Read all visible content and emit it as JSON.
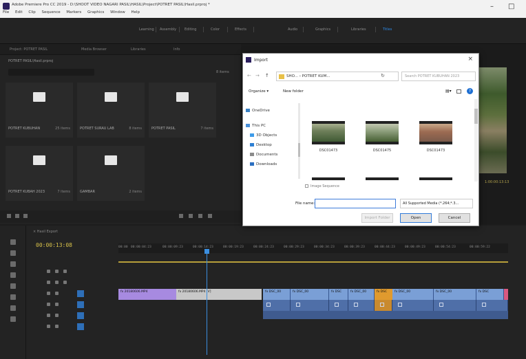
{
  "window": {
    "title": "Adobe Premiere Pro CC 2019 - D:\\SHOOT VIDEO NAGARI PASIL\\HASIL\\Project\\POTRET PASIL\\Hasil.prproj *",
    "menu": [
      "File",
      "Edit",
      "Clip",
      "Sequence",
      "Markers",
      "Graphics",
      "Window",
      "Help"
    ],
    "controls": {
      "minimize": "–",
      "maximize": "□"
    }
  },
  "workspace_tabs": [
    {
      "label": "Learning",
      "active": false
    },
    {
      "label": "Assembly",
      "active": false
    },
    {
      "label": "Editing",
      "active": false
    },
    {
      "label": "Color",
      "active": false
    },
    {
      "label": "Effects",
      "active": false
    },
    {
      "label": "Audio",
      "active": false
    },
    {
      "label": "Graphics",
      "active": false
    },
    {
      "label": "Libraries",
      "active": false
    },
    {
      "label": "Titles",
      "active": true
    }
  ],
  "project_panel": {
    "tabs": [
      "Project: POTRET PASIL",
      "Media Browser",
      "Libraries",
      "Info"
    ],
    "path": "POTRET PASIL\\Hasil.prproj",
    "count": "8 items",
    "bins": [
      {
        "name": "POTRET KUBUHAN",
        "items": "25 items"
      },
      {
        "name": "POTRET SURAU LAB",
        "items": "8 items"
      },
      {
        "name": "POTRET PASIL",
        "items": "7 items"
      },
      {
        "name": "POTRET KUBAH 2023",
        "items": "7 items"
      },
      {
        "name": "GAMBAR",
        "items": "2 items"
      }
    ]
  },
  "monitor": {
    "timecode": "1:00:00:13:13"
  },
  "timeline": {
    "tab": "× Hasil Export",
    "timecode": "00:00:13:08",
    "ruler_labels": [
      "00:00",
      "00:00:04:23",
      "00:00:09:23",
      "00:00:14:23",
      "00:00:19:23",
      "00:00:24:23",
      "00:00:29:23",
      "00:00:34:23",
      "00:00:39:23",
      "00:00:44:23",
      "00:00:49:23",
      "00:00:54:23",
      "00:00:59:22"
    ],
    "clips": [
      {
        "label": "fx 20180606.MP4",
        "color": "purple"
      },
      {
        "label": "fx 20180606.MP4 [V]",
        "color": "gray"
      },
      {
        "label": "fx DSC_00",
        "color": "blue"
      },
      {
        "label": "fx DSC_00",
        "color": "blue"
      },
      {
        "label": "fx DSC",
        "color": "blue"
      },
      {
        "label": "fx DSC_00",
        "color": "blue"
      },
      {
        "label": "fx DSC",
        "color": "orange"
      },
      {
        "label": "fx DSC_00",
        "color": "blue"
      },
      {
        "label": "fx DSC_00",
        "color": "blue"
      },
      {
        "label": "fx DSC",
        "color": "blue"
      }
    ]
  },
  "import_dialog": {
    "title": "Import",
    "close": "×",
    "address": "SHO... › POTRET KUM...",
    "search_placeholder": "Search POTRET KUBUHAN 2023",
    "organize": "Organize ▾",
    "new_folder": "New folder",
    "nav_items": [
      {
        "label": "OneDrive",
        "icon_color": "#3b82c4"
      },
      {
        "label": "This PC",
        "icon_color": "#4a90d9"
      },
      {
        "label": "3D Objects",
        "icon_color": "#3d9be9"
      },
      {
        "label": "Desktop",
        "icon_color": "#2d7fd3"
      },
      {
        "label": "Documents",
        "icon_color": "#8a8a8a"
      },
      {
        "label": "Downloads",
        "icon_color": "#2b6fc0"
      }
    ],
    "files": [
      {
        "name": "DSC01473",
        "colors": [
          "#6e7f5a",
          "#3f5a34",
          "#a8b08f"
        ]
      },
      {
        "name": "DSC01475",
        "colors": [
          "#8fa07e",
          "#465f33",
          "#c2c7b0"
        ]
      },
      {
        "name": "DSC01473",
        "colors": [
          "#7a5a4a",
          "#9c6b52",
          "#c9a98a"
        ]
      }
    ],
    "image_sequence": "Image Sequence",
    "file_name_label": "File name:",
    "file_name_value": "",
    "file_type": "All Supported Media (*.264;*.3...",
    "buttons": {
      "import_folder": "Import Folder",
      "open": "Open",
      "cancel": "Cancel"
    }
  }
}
